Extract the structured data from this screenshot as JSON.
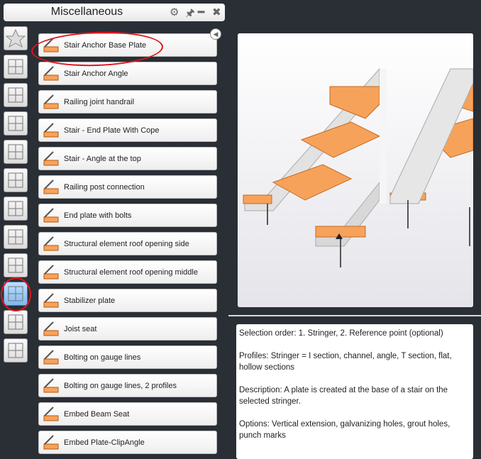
{
  "panel": {
    "title": "Miscellaneous",
    "icons": [
      "gear-icon",
      "pin-icon",
      "minimize-icon",
      "close-icon"
    ]
  },
  "sidebar": {
    "icons": [
      "star",
      "column-base",
      "splice",
      "roof",
      "bracing",
      "diagonal",
      "beam-column",
      "connection",
      "cross-bracing",
      "miscellaneous",
      "truss",
      "plate-detail"
    ],
    "selected_index": 9
  },
  "list": {
    "items": [
      {
        "label": "Stair Anchor Base Plate",
        "highlighted": true
      },
      {
        "label": "Stair Anchor Angle"
      },
      {
        "label": "Railing joint handrail"
      },
      {
        "label": "Stair - End Plate With Cope"
      },
      {
        "label": "Stair - Angle at the top"
      },
      {
        "label": "Railing post connection"
      },
      {
        "label": "End plate with bolts"
      },
      {
        "label": "Structural element roof opening side"
      },
      {
        "label": "Structural element roof opening middle"
      },
      {
        "label": "Stabilizer plate"
      },
      {
        "label": "Joist seat"
      },
      {
        "label": "Bolting on gauge lines"
      },
      {
        "label": "Bolting on gauge lines, 2 profiles"
      },
      {
        "label": "Embed Beam Seat"
      },
      {
        "label": "Embed Plate-ClipAngle"
      }
    ]
  },
  "description": {
    "selection": "Selection order: 1. Stringer, 2. Reference point (optional)",
    "profiles": "Profiles: Stringer = I section, channel, angle, T section, flat, hollow sections",
    "text": "Description: A plate is created at the base of a stair on the selected stringer.",
    "options": "Options: Vertical extension, galvanizing holes, grout holes, punch marks"
  },
  "colors": {
    "accent_orange": "#f7a25a",
    "annotation_red": "#e0151b",
    "background": "#2a2e35"
  }
}
